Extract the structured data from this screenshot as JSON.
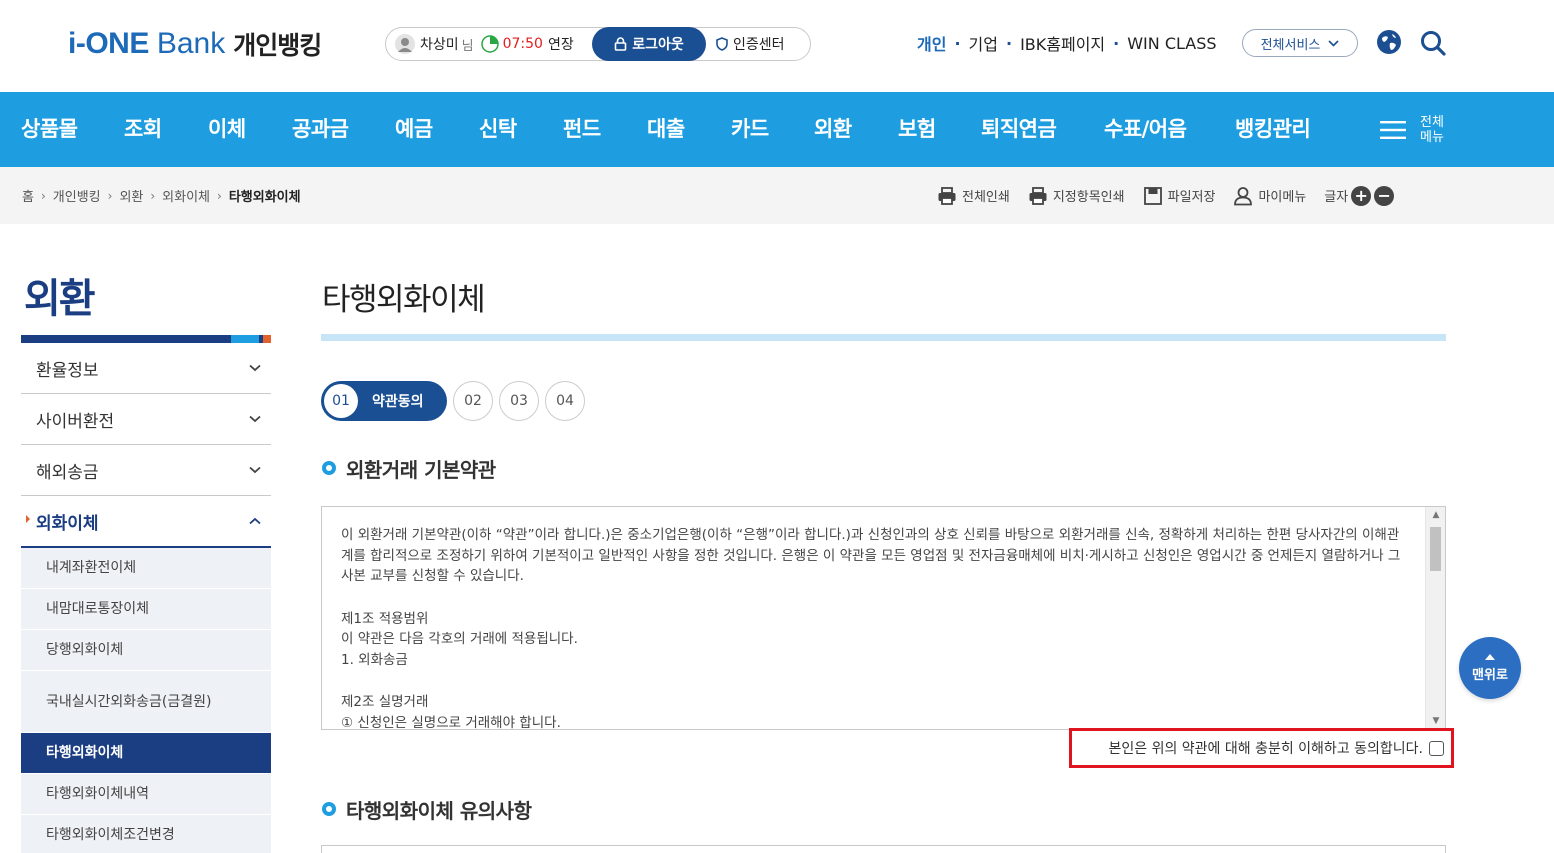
{
  "brand": {
    "logo_main": "i-ONE",
    "logo_bank": "Bank",
    "logo_sub": "개인뱅킹",
    "color": "#1c6ab8"
  },
  "session": {
    "user_name": "차상미",
    "user_suffix": "님",
    "timer": "07:50",
    "extend_label": "연장",
    "logout_label": "로그아웃",
    "cert_label": "인증센터"
  },
  "topnav": {
    "items": [
      "개인",
      "기업",
      "IBK홈페이지",
      "WIN CLASS"
    ],
    "all_services": "전체서비스"
  },
  "gnb": {
    "items": [
      "상품몰",
      "조회",
      "이체",
      "공과금",
      "예금",
      "신탁",
      "펀드",
      "대출",
      "카드",
      "외환",
      "보험",
      "퇴직연금",
      "수표/어음",
      "뱅킹관리"
    ],
    "all_menu": "전체 메뉴",
    "color": "#1e9ee0"
  },
  "breadcrumb": {
    "items": [
      "홈",
      "개인뱅킹",
      "외환",
      "외화이체"
    ],
    "current": "타행외화이체"
  },
  "tools": {
    "print_all": "전체인쇄",
    "print_selected": "지정항목인쇄",
    "save_file": "파일저장",
    "my_menu": "마이메뉴",
    "font_size": "글자"
  },
  "lnb": {
    "title": "외환",
    "menus": [
      "환율정보",
      "사이버환전",
      "해외송금",
      "외화이체"
    ],
    "submenu": [
      "내계좌환전이체",
      "내맘대로통장이체",
      "당행외화이체",
      "국내실시간외화송금(금결원)",
      "타행외화이체",
      "타행외화이체내역",
      "타행외화이체조건변경"
    ],
    "color": "#1b3e82"
  },
  "content": {
    "page_title": "타행외화이체",
    "steps": [
      {
        "num": "01",
        "label": "약관동의"
      },
      {
        "num": "02"
      },
      {
        "num": "03"
      },
      {
        "num": "04"
      }
    ],
    "section1_title": "외환거래 기본약관",
    "terms_paragraphs": [
      "이 외환거래 기본약관(이하 “약관”이라 합니다.)은 중소기업은행(이하 “은행”이라 합니다.)과 신청인과의 상호 신뢰를 바탕으로 외환거래를 신속, 정확하게 처리하는 한편 당사자간의 이해관계를 합리적으로 조정하기 위하여 기본적이고 일반적인 사항을 정한 것입니다. 은행은 이 약관을 모든 영업점 및 전자금융매체에 비치·게시하고 신청인은 영업시간 중 언제든지 열람하거나 그 사본 교부를 신청할 수 있습니다.",
      "제1조 적용범위",
      " 이 약관은 다음 각호의 거래에 적용됩니다.",
      " 1. 외화송금",
      "제2조 실명거래",
      " ① 신청인은 실명으로 거래해야 합니다."
    ],
    "agree_label": "본인은 위의 약관에 대해 충분히 이해하고 동의합니다.",
    "section2_title": "타행외화이체 유의사항",
    "totop_label": "맨위로",
    "highlight_color": "#e0141e"
  }
}
